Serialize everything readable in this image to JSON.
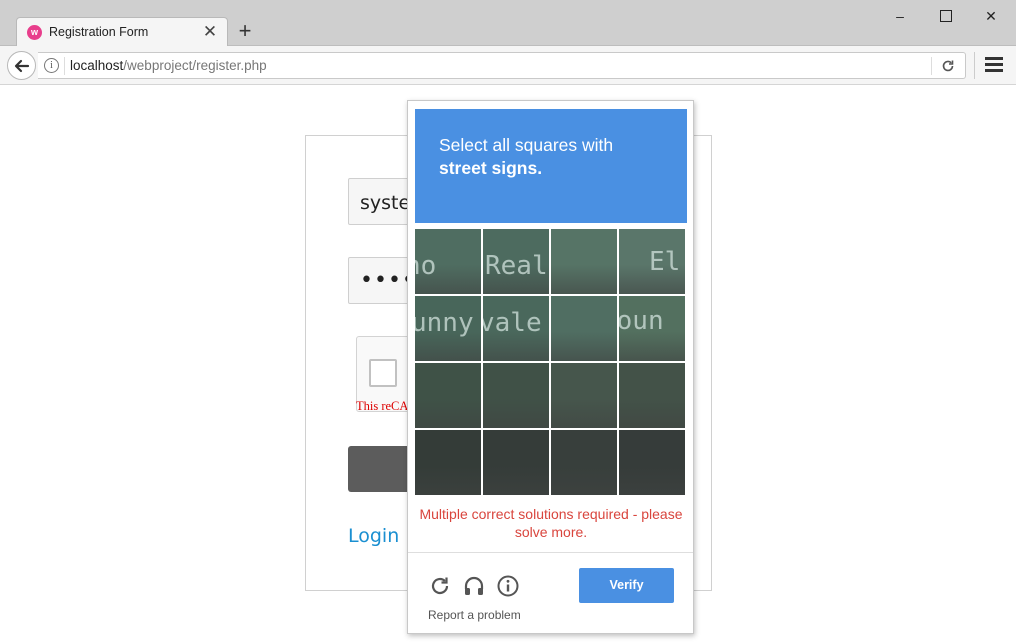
{
  "browser": {
    "tab_title": "Registration Form",
    "tab_close_glyph": "✕",
    "new_tab_glyph": "+",
    "window_minimize_glyph": "–",
    "window_close_glyph": "✕",
    "url_host": "localhost",
    "url_path": "/webproject/register.php"
  },
  "form": {
    "username_value": "system",
    "password_value": "••••••••",
    "captcha_error": "This reCAPTCHA is for testing purposes only.",
    "login_link": "Login"
  },
  "challenge": {
    "header_line1": "Select all squares with",
    "header_line2": "street signs.",
    "error_message": "Multiple correct solutions required - please solve more.",
    "verify_label": "Verify",
    "report_label": "Report a problem",
    "accent_color": "#4a90e2",
    "tiles": [
      {
        "label": "street-sign-tile",
        "text": "no",
        "bg": "#4f6d61"
      },
      {
        "label": "street-sign-tile",
        "text": "Real",
        "bg": "#4d6b5f"
      },
      {
        "label": "street-sign-tile",
        "text": "",
        "bg": "#567466"
      },
      {
        "label": "street-sign-tile",
        "text": "El",
        "bg": "#5a766a"
      },
      {
        "label": "street-sign-tile",
        "text": "unny",
        "bg": "#48665a"
      },
      {
        "label": "street-sign-tile",
        "text": "vale",
        "bg": "#4a685c"
      },
      {
        "label": "street-sign-tile",
        "text": "",
        "bg": "#506e62"
      },
      {
        "label": "street-sign-tile",
        "text": "Moun",
        "bg": "#53705f"
      },
      {
        "label": "dark-tile",
        "text": "",
        "bg": "#3f5247"
      },
      {
        "label": "dark-tile",
        "text": "",
        "bg": "#405147"
      },
      {
        "label": "dark-tile",
        "text": "",
        "bg": "#46564c"
      },
      {
        "label": "dark-tile",
        "text": "",
        "bg": "#435248"
      },
      {
        "label": "dark-tile",
        "text": "",
        "bg": "#343c38"
      },
      {
        "label": "dark-tile",
        "text": "",
        "bg": "#353c39"
      },
      {
        "label": "dark-tile",
        "text": "",
        "bg": "#383f3c"
      },
      {
        "label": "dark-tile",
        "text": "",
        "bg": "#363c3a"
      }
    ]
  }
}
